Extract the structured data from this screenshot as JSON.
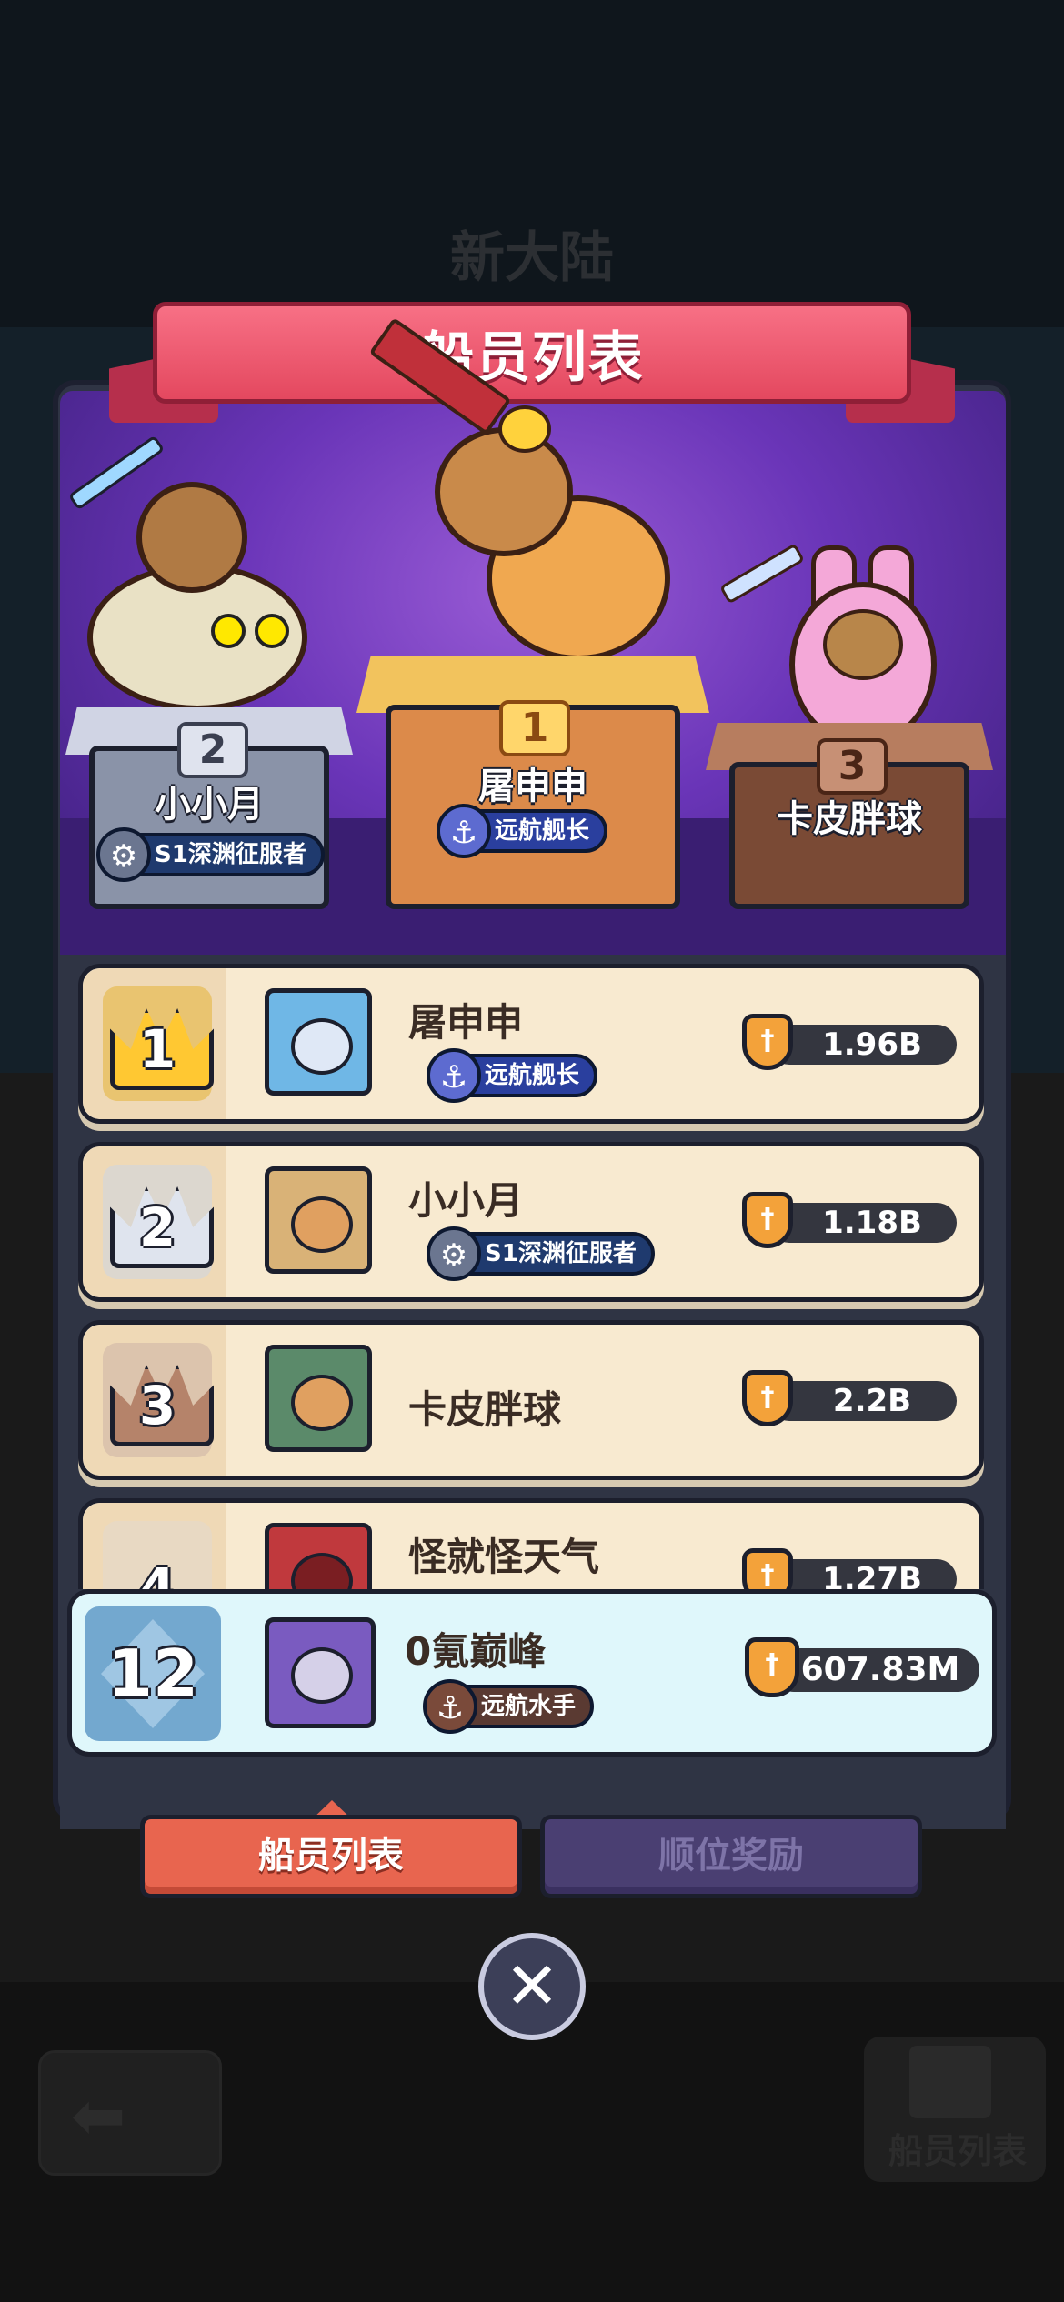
{
  "background": {
    "title": "新大陆",
    "crew_button_label": "船员列表"
  },
  "panel": {
    "title": "船员列表"
  },
  "podium": [
    {
      "rank": "2",
      "name": "小小月",
      "title": "S1深渊征服者"
    },
    {
      "rank": "1",
      "name": "屠申申",
      "title": "远航舰长"
    },
    {
      "rank": "3",
      "name": "卡皮胖球"
    }
  ],
  "leaderboard": [
    {
      "rank": "1",
      "name": "屠申申",
      "title": "远航舰长",
      "power": "1.96B"
    },
    {
      "rank": "2",
      "name": "小小月",
      "title": "S1深渊征服者",
      "power": "1.18B"
    },
    {
      "rank": "3",
      "name": "卡皮胖球",
      "power": "2.2B"
    },
    {
      "rank": "4",
      "name": "怪就怪天气",
      "power": "1.27B"
    }
  ],
  "self": {
    "rank": "12",
    "name": "0氪巅峰",
    "title": "远航水手",
    "power": "607.83M"
  },
  "tabs": {
    "crew_list": "船员列表",
    "rank_rewards": "顺位奖励"
  },
  "icons": {
    "close": "close-icon",
    "back": "back-arrow-icon",
    "power": "sword-shield-icon"
  },
  "colors": {
    "ribbon": "#e4485f",
    "active_tab": "#e8654f",
    "inactive_tab": "#4a3f72",
    "self_row": "#dff7fb"
  }
}
